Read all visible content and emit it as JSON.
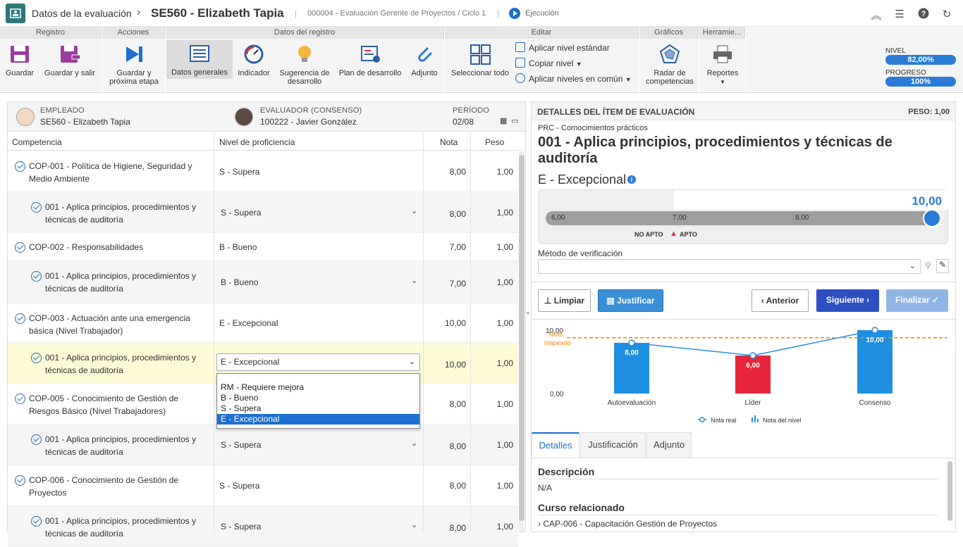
{
  "header": {
    "section": "Datos de la evaluación",
    "title": "SE560 - Elizabeth Tapia",
    "subtitle": "000004 - Evaluación Gerente de Proyectos / Ciclo 1",
    "status": "Ejecución",
    "icons": [
      "collapse-icon",
      "list-icon",
      "help-icon",
      "refresh-icon"
    ]
  },
  "ribbon": {
    "groups": {
      "registro": "Registro",
      "acciones": "Acciones",
      "datos": "Datos del registro",
      "editar": "Editar",
      "graficos": "Gráficos",
      "herramientas": "Herramie..."
    },
    "buttons": {
      "guardar": "Guardar",
      "guardar_salir": "Guardar y salir",
      "guardar_prox_1": "Guardar y",
      "guardar_prox_2": "próxima etapa",
      "datos_generales": "Datos generales",
      "indicador": "Indicador",
      "sugerencia_1": "Sugerencia de",
      "sugerencia_2": "desarrollo",
      "plan": "Plan de desarrollo",
      "adjunto": "Adjunto",
      "seleccionar": "Seleccionar todo",
      "aplicar_nivel": "Aplicar nivel estándar",
      "copiar_nivel": "Copiar nivel",
      "aplicar_comun": "Aplicar niveles en común",
      "radar_1": "Radar de",
      "radar_2": "competencias",
      "reportes": "Reportes"
    },
    "progress": {
      "nivel_label": "NIVEL",
      "nivel_value": "82,00%",
      "nivel_fraction": 0.82,
      "progreso_label": "PROGRESO",
      "progreso_value": "100%",
      "progreso_fraction": 1.0
    }
  },
  "left": {
    "empleado_label": "EMPLEADO",
    "empleado": "SE560 - Elizabeth Tapia",
    "evaluador_label": "EVALUADOR (CONSENSO)",
    "evaluador": "100222 - Javier González",
    "periodo_label": "PERÍODO",
    "periodo": "02/08",
    "columns": {
      "competencia": "Competencia",
      "nivel": "Nivel de proficiencia",
      "nota": "Nota",
      "peso": "Peso"
    },
    "rows": [
      {
        "l1": "COP-001 - Política de Higiene, Seguridad y",
        "l2": "Medio Ambiente",
        "nivel": "S - Supera",
        "nota": "8,00",
        "peso": "1,00"
      },
      {
        "l1": "001 - Aplica principios, procedimientos y",
        "l2": "técnicas de auditoría",
        "nivel": "S - Supera",
        "nota": "8,00",
        "peso": "1,00"
      },
      {
        "l1": "COP-002 - Responsabilidades",
        "l2": "",
        "nivel": "B - Bueno",
        "nota": "7,00",
        "peso": "1,00"
      },
      {
        "l1": "001 - Aplica principios, procedimientos y",
        "l2": "técnicas de auditoría",
        "nivel": "B - Bueno",
        "nota": "7,00",
        "peso": "1,00"
      },
      {
        "l1": "COP-003 - Actuación ante una emergencia",
        "l2": "básica (Nivel Trabajador)",
        "nivel": "E - Excepcional",
        "nota": "10,00",
        "peso": "1,00"
      },
      {
        "l1": "001 - Aplica principios, procedimientos y",
        "l2": "técnicas de auditoría",
        "nivel": "E - Excepcional",
        "nota": "10,00",
        "peso": "1,00"
      },
      {
        "l1": "COP-005 - Conocimiento de Gestión de",
        "l2": "Riesgos Básico (Nivel Trabajadores)",
        "nivel": "",
        "nota": "8,00",
        "peso": "1,00"
      },
      {
        "l1": "001 - Aplica principios, procedimientos y",
        "l2": "técnicas de auditoría",
        "nivel": "S - Supera",
        "nota": "8,00",
        "peso": "1,00"
      },
      {
        "l1": "COP-006 - Conocimiento de Gestión de",
        "l2": "Proyectos",
        "nivel": "S - Supera",
        "nota": "8,00",
        "peso": "1,00"
      },
      {
        "l1": "001 - Aplica principios, procedimientos y",
        "l2": "técnicas de auditoría",
        "nivel": "S - Supera",
        "nota": "8,00",
        "peso": "1,00"
      }
    ],
    "dropdown_options": [
      "RM - Requiere mejora",
      "B - Bueno",
      "S - Supera",
      "E - Excepcional"
    ],
    "dropdown_selected": "E - Excepcional"
  },
  "right": {
    "panel_title": "DETALLES DEL ÍTEM DE EVALUACIÓN",
    "peso": "PESO: 1,00",
    "category": "PRC - Comocimientos prácticos",
    "item_title_1": "001 - Aplica principios, procedimientos y técnicas de",
    "item_title_2": "auditoría",
    "level": "E - Excepcional",
    "score": "10,00",
    "slider": {
      "ticks": [
        "6,00",
        "7,00",
        "8,00"
      ],
      "no_apto": "NO APTO",
      "apto": "APTO",
      "value": 10
    },
    "metodo_label": "Método de verificación",
    "metodo_value": "",
    "buttons": {
      "limpiar": "Limpiar",
      "justificar": "Justificar",
      "anterior": "Anterior",
      "siguiente": "Siguiente",
      "finalizar": "Finalizar"
    },
    "tabs": [
      "Detalles",
      "Justificación",
      "Adjunto"
    ],
    "descripcion_label": "Descripción",
    "descripcion": "N/A",
    "curso_label": "Curso relacionado",
    "curso": "› CAP-006 - Capacitación Gestión de Proyectos"
  },
  "chart_data": {
    "type": "bar",
    "categories": [
      "Autoevaluación",
      "Líder",
      "Consenso"
    ],
    "series": [
      {
        "name": "Nota del nivel",
        "values": [
          8,
          6,
          10
        ]
      },
      {
        "name": "Nota real",
        "values": [
          8,
          6,
          10
        ]
      }
    ],
    "bar_labels": [
      "8,00",
      "6,00",
      "10,00"
    ],
    "bar_colors": [
      "#1e8fe1",
      "#e8263b",
      "#1e8fe1"
    ],
    "ylim": [
      0,
      10
    ],
    "yticks": [
      "0,00",
      "10,00"
    ],
    "reference_line": {
      "label_1": "Nivel",
      "label_2": "mapeado",
      "value": 8.8,
      "color": "#f08c00"
    },
    "legend": [
      "Nota real",
      "Nota del nivel"
    ]
  },
  "colors": {
    "accent": "#1e6fd0",
    "primary_button": "#2e4fc2",
    "justify_button": "#3a8fd7"
  }
}
